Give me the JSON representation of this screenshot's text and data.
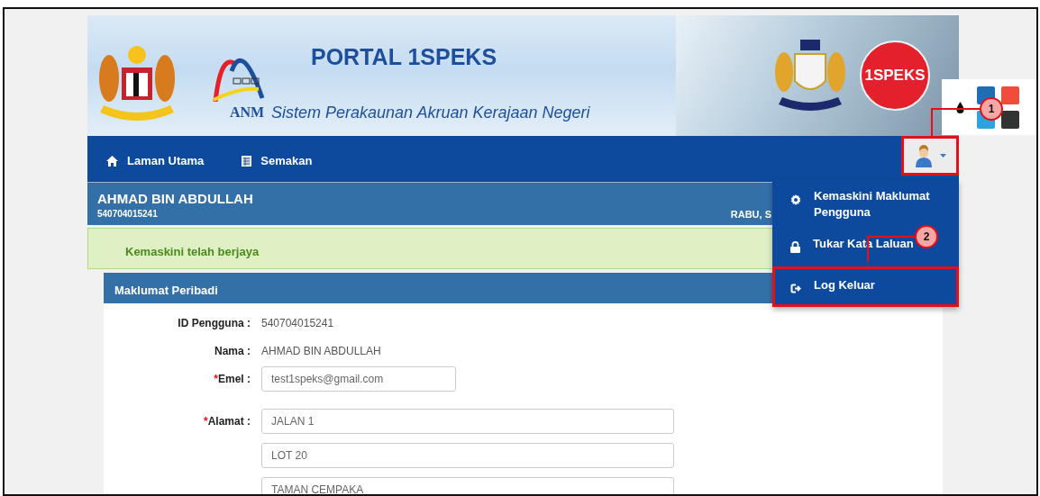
{
  "header": {
    "title": "PORTAL 1SPEKS",
    "subtitle": "Sistem Perakaunan Akruan Kerajaan Negeri",
    "agency_logo_text": "ANM",
    "badge_text": "1SPEKS"
  },
  "nav": [
    {
      "label": "Laman Utama"
    },
    {
      "label": "Semakan"
    }
  ],
  "user_button": {
    "highlighted": true
  },
  "user_bar": {
    "name": "AHMAD BIN ABDULLAH",
    "id": "540704015241",
    "date": "RABU, S"
  },
  "alert": {
    "message": "Kemaskini telah berjaya"
  },
  "panel": {
    "title": "Maklumat Peribadi",
    "fields": [
      {
        "kind": "static",
        "label": "ID Pengguna :",
        "value": "540704015241"
      },
      {
        "kind": "static",
        "label": "Nama :",
        "value": "AHMAD BIN ABDULLAH"
      },
      {
        "kind": "input",
        "required_mark": "*",
        "label": "Emel :",
        "values": [
          "test1speks@gmail.com"
        ]
      },
      {
        "kind": "input",
        "required_mark": "*",
        "label": "Alamat :",
        "values": [
          "JALAN 1",
          "LOT 20",
          "TAMAN CEMPAKA"
        ]
      }
    ]
  },
  "user_menu": [
    {
      "label": "Kemaskini Maklumat Pengguna",
      "highlighted": false
    },
    {
      "label": "Tukar Kata Laluan",
      "highlighted": false
    },
    {
      "label": "Log Keluar",
      "highlighted": true
    }
  ],
  "theme_swatches": [
    {
      "color": "#1f6db5"
    },
    {
      "color": "#f04b3b"
    },
    {
      "color": "#2ba3e0"
    },
    {
      "color": "#333333"
    }
  ],
  "callouts": [
    {
      "number": "1"
    },
    {
      "number": "2"
    }
  ]
}
